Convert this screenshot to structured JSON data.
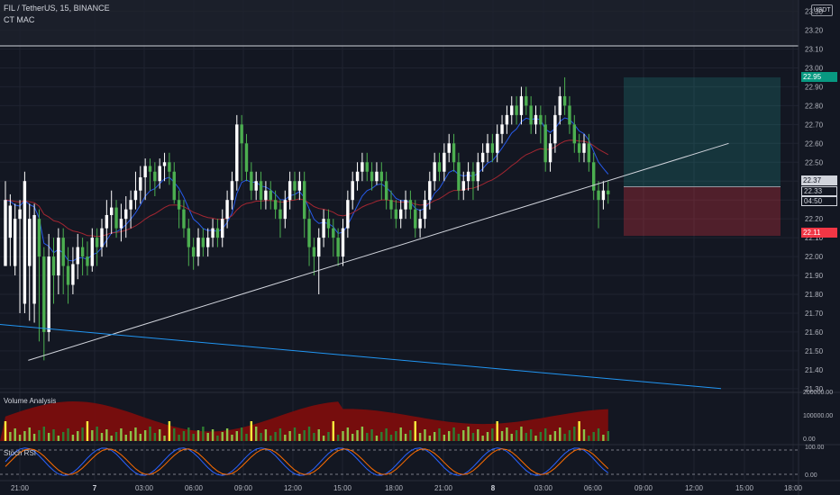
{
  "header": {
    "symbol": "FIL / TetherUS",
    "interval": "15",
    "exchange": "BINANCE",
    "indicator": "CT MAC"
  },
  "price_scale": {
    "currency": "USDT",
    "labels": [
      "23.30",
      "23.20",
      "23.10",
      "23.00",
      "22.90",
      "22.80",
      "22.70",
      "22.60",
      "22.50",
      "22.40",
      "22.30",
      "22.20",
      "22.10",
      "22.00",
      "21.90",
      "21.80",
      "21.70",
      "21.60",
      "21.50",
      "21.40",
      "21.30"
    ],
    "tags": {
      "target": "22.95",
      "entry": "22.37",
      "last": "22.33",
      "countdown": "04:50",
      "stop": "22.11"
    }
  },
  "time_axis": {
    "labels": [
      "21:00",
      "7",
      "03:00",
      "06:00",
      "09:00",
      "12:00",
      "15:00",
      "18:00",
      "21:00",
      "8",
      "03:00",
      "06:00",
      "09:00",
      "12:00",
      "15:00",
      "18:00"
    ]
  },
  "volume_pane": {
    "title": "Volume Analysis",
    "scale": [
      "200000.00",
      "100000.00",
      "0.00"
    ]
  },
  "rsi_pane": {
    "title": "Stoch RSI",
    "scale": [
      "100.00",
      "0.00"
    ]
  },
  "colors": {
    "background": "#131722",
    "up": "#ffffff",
    "down": "#4caf50",
    "target_zone": "#26a69a",
    "stop_zone": "#f23645",
    "trendline_up": "#d1d4dc",
    "trendline_down": "#2196f3"
  },
  "chart_data": {
    "type": "candlestick",
    "ylim": [
      21.28,
      23.36
    ],
    "candles": [
      [
        21.95,
        22.3,
        22.2,
        22.4
      ],
      [
        22.1,
        22.27,
        21.95,
        22.33
      ],
      [
        21.95,
        22.2,
        21.9,
        22.28
      ],
      [
        22.2,
        22.25,
        21.7,
        22.3
      ],
      [
        21.75,
        22.4,
        21.7,
        22.45
      ],
      [
        21.95,
        22.2,
        21.66,
        22.28
      ],
      [
        21.75,
        22.22,
        21.65,
        22.28
      ],
      [
        22.2,
        22.0,
        21.55,
        22.25
      ],
      [
        22.0,
        21.6,
        21.45,
        22.05
      ],
      [
        21.6,
        22.0,
        21.55,
        22.12
      ],
      [
        22.0,
        21.9,
        21.75,
        22.1
      ],
      [
        21.9,
        22.1,
        21.8,
        22.15
      ],
      [
        22.1,
        21.95,
        21.8,
        22.15
      ],
      [
        21.95,
        21.85,
        21.75,
        22.05
      ],
      [
        21.85,
        21.96,
        21.8,
        22.05
      ],
      [
        21.96,
        22.05,
        21.88,
        22.12
      ],
      [
        22.05,
        22.0,
        21.9,
        22.1
      ],
      [
        22.0,
        21.95,
        21.9,
        22.08
      ],
      [
        21.95,
        22.1,
        21.92,
        22.15
      ],
      [
        22.1,
        22.05,
        21.95,
        22.15
      ],
      [
        22.05,
        22.15,
        22.0,
        22.2
      ],
      [
        22.15,
        22.22,
        22.05,
        22.3
      ],
      [
        22.22,
        22.26,
        22.12,
        22.35
      ],
      [
        22.26,
        22.15,
        22.1,
        22.3
      ],
      [
        22.15,
        22.2,
        22.08,
        22.28
      ],
      [
        22.2,
        22.25,
        22.1,
        22.32
      ],
      [
        22.25,
        22.3,
        22.15,
        22.35
      ],
      [
        22.3,
        22.35,
        22.25,
        22.45
      ],
      [
        22.35,
        22.42,
        22.28,
        22.48
      ],
      [
        22.42,
        22.48,
        22.3,
        22.52
      ],
      [
        22.48,
        22.45,
        22.35,
        22.52
      ],
      [
        22.45,
        22.4,
        22.32,
        22.5
      ],
      [
        22.4,
        22.48,
        22.36,
        22.52
      ],
      [
        22.48,
        22.5,
        22.4,
        22.55
      ],
      [
        22.5,
        22.45,
        22.38,
        22.55
      ],
      [
        22.45,
        22.3,
        22.28,
        22.5
      ],
      [
        22.3,
        22.25,
        22.15,
        22.35
      ],
      [
        22.25,
        22.15,
        22.1,
        22.3
      ],
      [
        22.15,
        22.05,
        21.95,
        22.2
      ],
      [
        22.05,
        22.0,
        21.93,
        22.1
      ],
      [
        22.0,
        22.1,
        21.95,
        22.15
      ],
      [
        22.1,
        22.05,
        22.0,
        22.15
      ],
      [
        22.05,
        22.1,
        22.0,
        22.15
      ],
      [
        22.1,
        22.15,
        22.05,
        22.2
      ],
      [
        22.15,
        22.1,
        22.05,
        22.2
      ],
      [
        22.1,
        22.2,
        22.05,
        22.25
      ],
      [
        22.2,
        22.3,
        22.15,
        22.35
      ],
      [
        22.3,
        22.4,
        22.25,
        22.45
      ],
      [
        22.4,
        22.7,
        22.35,
        22.75
      ],
      [
        22.7,
        22.6,
        22.4,
        22.75
      ],
      [
        22.6,
        22.45,
        22.4,
        22.65
      ],
      [
        22.45,
        22.35,
        22.3,
        22.5
      ],
      [
        22.35,
        22.4,
        22.3,
        22.45
      ],
      [
        22.4,
        22.3,
        22.25,
        22.45
      ],
      [
        22.3,
        22.35,
        22.25,
        22.4
      ],
      [
        22.35,
        22.3,
        22.25,
        22.4
      ],
      [
        22.3,
        22.25,
        22.2,
        22.35
      ],
      [
        22.25,
        22.2,
        22.1,
        22.3
      ],
      [
        22.2,
        22.3,
        22.15,
        22.35
      ],
      [
        22.3,
        22.4,
        22.25,
        22.45
      ],
      [
        22.4,
        22.35,
        22.3,
        22.45
      ],
      [
        22.35,
        22.4,
        22.3,
        22.45
      ],
      [
        22.4,
        22.2,
        22.1,
        22.45
      ],
      [
        22.2,
        22.05,
        21.95,
        22.25
      ],
      [
        22.05,
        22.0,
        21.9,
        22.1
      ],
      [
        22.0,
        22.1,
        21.8,
        22.15
      ],
      [
        22.1,
        22.2,
        22.05,
        22.25
      ],
      [
        22.2,
        22.15,
        22.1,
        22.25
      ],
      [
        22.15,
        22.1,
        22.0,
        22.2
      ],
      [
        22.1,
        22.0,
        21.95,
        22.15
      ],
      [
        22.0,
        22.15,
        21.95,
        22.2
      ],
      [
        22.15,
        22.3,
        22.1,
        22.35
      ],
      [
        22.3,
        22.4,
        22.25,
        22.45
      ],
      [
        22.4,
        22.45,
        22.35,
        22.5
      ],
      [
        22.45,
        22.5,
        22.4,
        22.55
      ],
      [
        22.5,
        22.45,
        22.4,
        22.55
      ],
      [
        22.45,
        22.4,
        22.35,
        22.5
      ],
      [
        22.4,
        22.45,
        22.38,
        22.5
      ],
      [
        22.45,
        22.4,
        22.3,
        22.5
      ],
      [
        22.4,
        22.3,
        22.25,
        22.45
      ],
      [
        22.3,
        22.25,
        22.2,
        22.35
      ],
      [
        22.25,
        22.2,
        22.15,
        22.3
      ],
      [
        22.2,
        22.25,
        22.15,
        22.3
      ],
      [
        22.25,
        22.3,
        22.2,
        22.35
      ],
      [
        22.3,
        22.25,
        22.2,
        22.35
      ],
      [
        22.25,
        22.15,
        22.1,
        22.3
      ],
      [
        22.15,
        22.2,
        22.1,
        22.25
      ],
      [
        22.2,
        22.3,
        22.15,
        22.35
      ],
      [
        22.3,
        22.4,
        22.25,
        22.45
      ],
      [
        22.4,
        22.5,
        22.35,
        22.55
      ],
      [
        22.5,
        22.45,
        22.4,
        22.55
      ],
      [
        22.45,
        22.55,
        22.4,
        22.6
      ],
      [
        22.55,
        22.6,
        22.5,
        22.65
      ],
      [
        22.6,
        22.5,
        22.45,
        22.65
      ],
      [
        22.5,
        22.35,
        22.3,
        22.55
      ],
      [
        22.35,
        22.4,
        22.3,
        22.45
      ],
      [
        22.4,
        22.45,
        22.35,
        22.5
      ],
      [
        22.45,
        22.4,
        22.3,
        22.5
      ],
      [
        22.4,
        22.5,
        22.35,
        22.55
      ],
      [
        22.5,
        22.55,
        22.45,
        22.6
      ],
      [
        22.55,
        22.6,
        22.5,
        22.65
      ],
      [
        22.6,
        22.55,
        22.5,
        22.65
      ],
      [
        22.55,
        22.65,
        22.5,
        22.7
      ],
      [
        22.65,
        22.7,
        22.6,
        22.75
      ],
      [
        22.7,
        22.75,
        22.65,
        22.8
      ],
      [
        22.75,
        22.8,
        22.7,
        22.85
      ],
      [
        22.8,
        22.75,
        22.7,
        22.85
      ],
      [
        22.75,
        22.85,
        22.7,
        22.9
      ],
      [
        22.85,
        22.8,
        22.75,
        22.9
      ],
      [
        22.8,
        22.7,
        22.65,
        22.85
      ],
      [
        22.7,
        22.75,
        22.65,
        22.8
      ],
      [
        22.75,
        22.7,
        22.6,
        22.8
      ],
      [
        22.7,
        22.5,
        22.45,
        22.75
      ],
      [
        22.5,
        22.6,
        22.45,
        22.65
      ],
      [
        22.6,
        22.75,
        22.55,
        22.8
      ],
      [
        22.75,
        22.85,
        22.7,
        22.9
      ],
      [
        22.85,
        22.8,
        22.75,
        22.95
      ],
      [
        22.8,
        22.7,
        22.65,
        22.85
      ],
      [
        22.7,
        22.6,
        22.55,
        22.75
      ],
      [
        22.6,
        22.55,
        22.5,
        22.65
      ],
      [
        22.55,
        22.6,
        22.5,
        22.65
      ],
      [
        22.6,
        22.5,
        22.45,
        22.65
      ],
      [
        22.5,
        22.35,
        22.3,
        22.55
      ],
      [
        22.35,
        22.3,
        22.15,
        22.4
      ],
      [
        22.3,
        22.35,
        22.25,
        22.4
      ],
      [
        22.35,
        22.33,
        22.28,
        22.4
      ]
    ],
    "trendline_up": {
      "from": [
        -0.5,
        21.45
      ],
      "to": [
        150,
        22.6
      ]
    },
    "trendline_down": {
      "from": [
        -0.5,
        21.64
      ],
      "to": [
        126,
        21.3
      ]
    },
    "position": {
      "target": 22.95,
      "entry": 22.37,
      "stop": 22.11
    }
  }
}
